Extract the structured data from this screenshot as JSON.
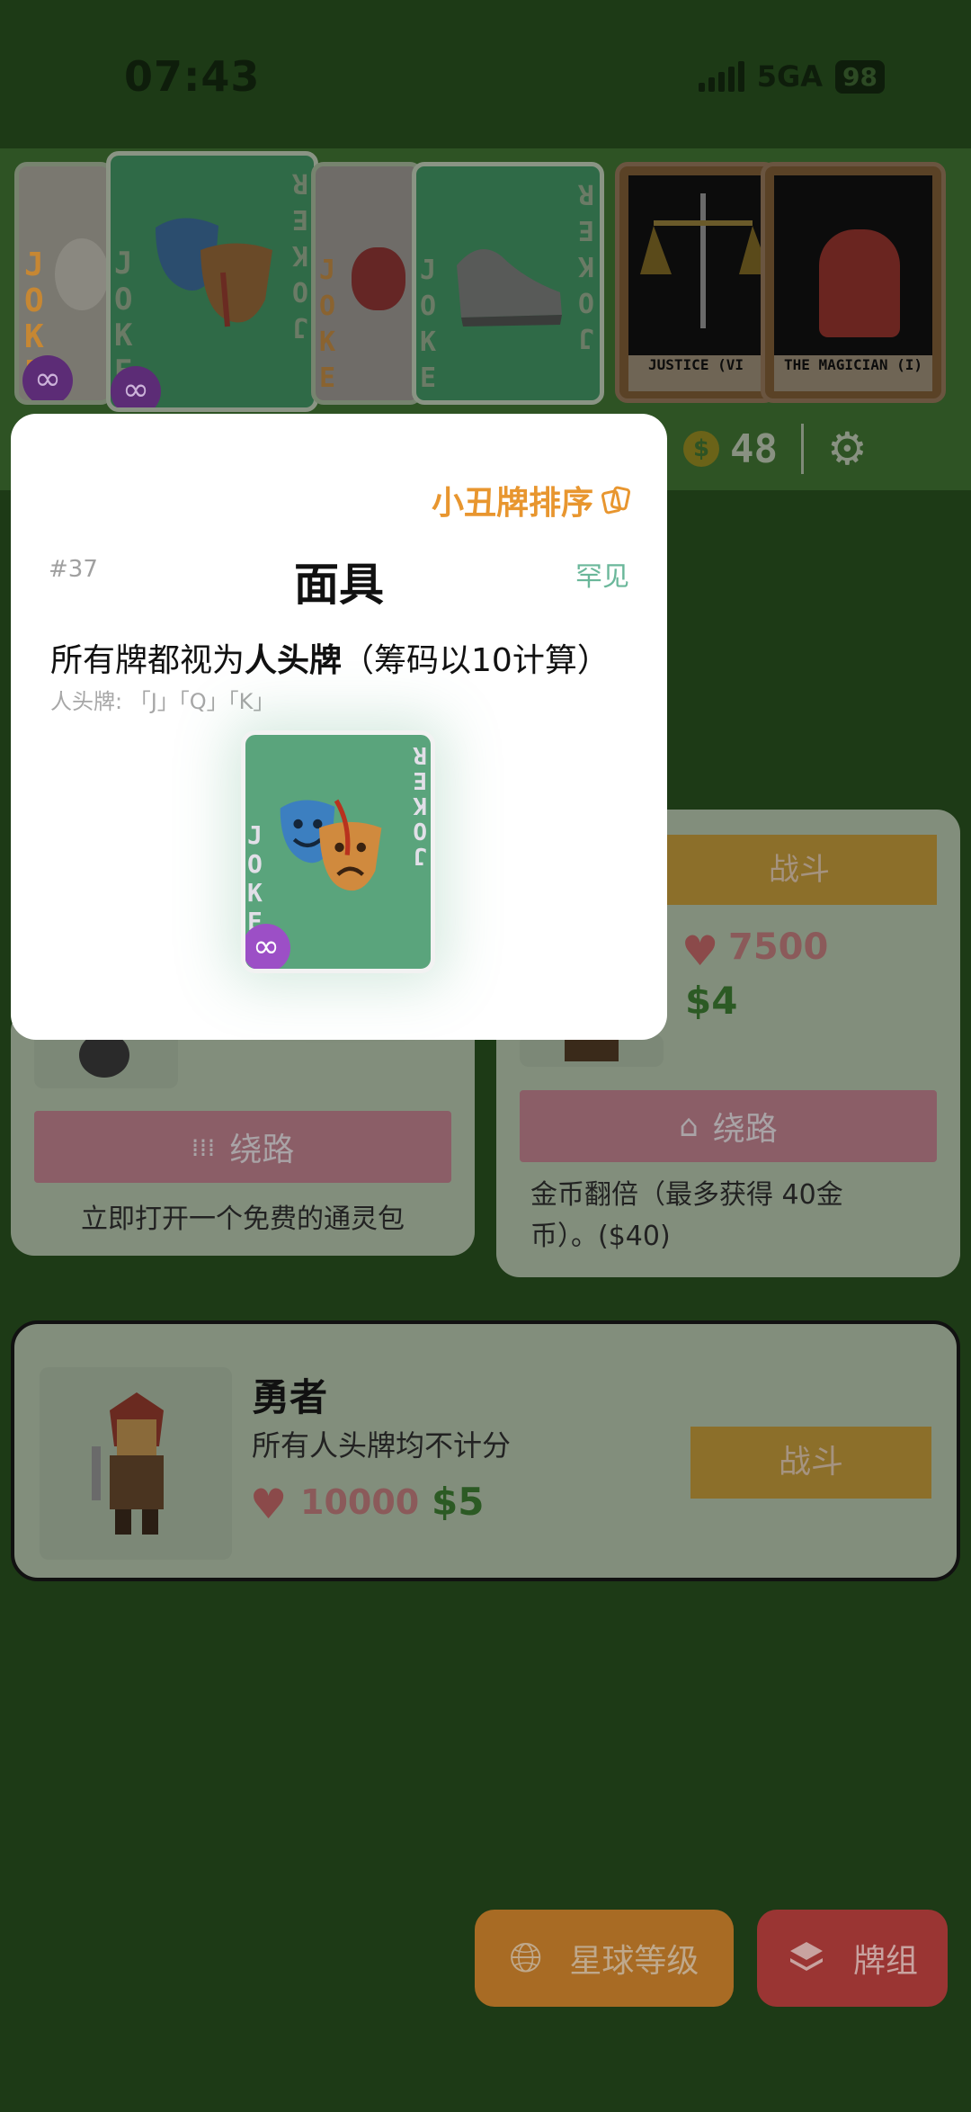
{
  "status": {
    "time": "07:43",
    "network": "5GA",
    "battery": "98"
  },
  "strip": {
    "jokers": [
      {
        "name": "mouse-joker",
        "label": "JOKE"
      },
      {
        "name": "masks-joker",
        "label": "JOKE",
        "mirror": "JOKER"
      },
      {
        "name": "glove-joker",
        "label": "JOKER",
        "mirror": "JOKER"
      },
      {
        "name": "shoe-joker",
        "label": "JOKER",
        "mirror": "JOKER"
      }
    ],
    "tarots": [
      {
        "label": "JUSTICE (VI"
      },
      {
        "label": "THE MAGICIAN (I)"
      }
    ],
    "infinity": "∞",
    "coin_symbol": "$",
    "money": "48"
  },
  "modal": {
    "sort_link": "小丑牌排序",
    "number": "#37",
    "title": "面具",
    "rarity": "罕见",
    "desc_prefix": "所有牌都视为",
    "desc_bold": "人头牌",
    "desc_suffix": "（筹码以10计算）",
    "sub": "人头牌: 「J」「Q」「K」",
    "card_label": "JOKE",
    "card_mirror": "JOKER",
    "infinity": "∞"
  },
  "left_panel": {
    "skip_label": "绕路",
    "reward": "立即打开一个免费的通灵包"
  },
  "right_panel": {
    "fight_label": "战斗",
    "hp": "7500",
    "reward_money": "$4",
    "skip_label": "绕路",
    "reward": "金币翻倍（最多获得 40金币）。($40)"
  },
  "boss": {
    "name": "勇者",
    "desc": "所有人头牌均不计分",
    "hp": "10000",
    "reward_money": "$5",
    "fight_label": "战斗"
  },
  "footer": {
    "planet_label": "星球等级",
    "deck_label": "牌组"
  },
  "colors": {
    "bg": "#1d3a16",
    "accent_orange": "#e8962f",
    "rarity_green": "#6ab79a",
    "joker_green": "#5aa47c"
  }
}
